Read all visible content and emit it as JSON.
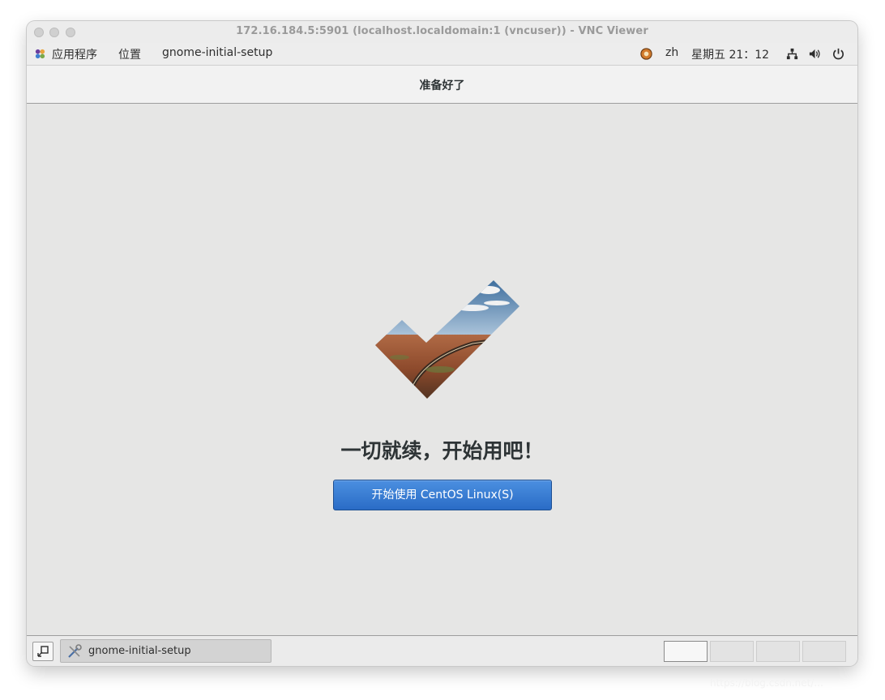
{
  "vnc_window": {
    "title": "172.16.184.5:5901 (localhost.localdomain:1 (vncuser)) - VNC Viewer"
  },
  "top_bar": {
    "applications_label": "应用程序",
    "places_label": "位置",
    "app_name": "gnome-initial-setup",
    "input_method": "zh",
    "clock": "星期五 21：12",
    "icons": [
      "gnome-apps-icon",
      "input-method-icon",
      "network-icon",
      "volume-icon",
      "power-icon"
    ]
  },
  "header": {
    "title": "准备好了"
  },
  "main": {
    "heading": "一切就续，开始用吧！",
    "start_button_label": "开始使用 CentOS Linux(S)",
    "accent_color": "#2f71c9"
  },
  "bottom_panel": {
    "task_label": "gnome-initial-setup",
    "workspaces": [
      {
        "active": true
      },
      {
        "active": false
      },
      {
        "active": false
      },
      {
        "active": false
      }
    ]
  },
  "watermark": "https://blog.csdn.net/..."
}
